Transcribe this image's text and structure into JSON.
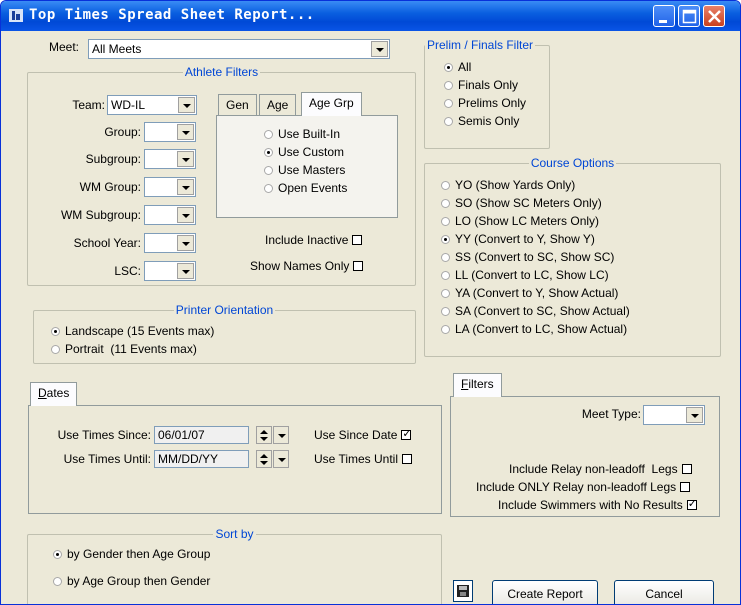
{
  "window": {
    "title": "Top Times Spread Sheet Report..."
  },
  "meet": {
    "label": "Meet:",
    "value": "All Meets"
  },
  "athlete_filters": {
    "legend": "Athlete Filters",
    "team": {
      "label": "Team:",
      "value": "WD-IL"
    },
    "group": {
      "label": "Group:",
      "value": ""
    },
    "subgroup": {
      "label": "Subgroup:",
      "value": ""
    },
    "wm_group": {
      "label": "WM Group:",
      "value": ""
    },
    "wm_subgroup": {
      "label": "WM Subgroup:",
      "value": ""
    },
    "school_year": {
      "label": "School Year:",
      "value": ""
    },
    "lsc": {
      "label": "LSC:",
      "value": ""
    },
    "tabs": [
      "Gen",
      "Age",
      "Age Grp"
    ],
    "age_options": [
      {
        "label": "Use Built-In",
        "selected": false
      },
      {
        "label": "Use Custom",
        "selected": true
      },
      {
        "label": "Use Masters",
        "selected": false
      },
      {
        "label": "Open Events",
        "selected": false
      }
    ],
    "include_inactive": {
      "label": "Include Inactive",
      "checked": false
    },
    "show_names_only": {
      "label": "Show Names Only",
      "checked": false
    }
  },
  "prelim_filter": {
    "legend": "Prelim / Finals Filter",
    "options": [
      {
        "label": "All",
        "selected": true
      },
      {
        "label": "Finals Only",
        "selected": false
      },
      {
        "label": "Prelims Only",
        "selected": false
      },
      {
        "label": "Semis Only",
        "selected": false
      }
    ]
  },
  "course_options": {
    "legend": "Course Options",
    "options": [
      {
        "label": "YO (Show Yards Only)",
        "selected": false
      },
      {
        "label": "SO (Show SC Meters Only)",
        "selected": false
      },
      {
        "label": "LO (Show LC Meters Only)",
        "selected": false
      },
      {
        "label": "YY (Convert to Y, Show Y)",
        "selected": true
      },
      {
        "label": "SS (Convert to SC, Show SC)",
        "selected": false
      },
      {
        "label": "LL (Convert to LC, Show LC)",
        "selected": false
      },
      {
        "label": "YA (Convert to Y, Show Actual)",
        "selected": false
      },
      {
        "label": "SA (Convert to SC, Show Actual)",
        "selected": false
      },
      {
        "label": "LA (Convert to LC, Show Actual)",
        "selected": false
      }
    ]
  },
  "printer": {
    "legend": "Printer Orientation",
    "options": [
      {
        "label": "Landscape (15 Events max)",
        "selected": true
      },
      {
        "label": "Portrait  (11 Events max)",
        "selected": false
      }
    ]
  },
  "dates": {
    "tab_first": "D",
    "tab_rest": "ates",
    "since": {
      "label": "Use Times Since:",
      "value": "06/01/07"
    },
    "until": {
      "label": "Use Times Until:",
      "value": "MM/DD/YY"
    },
    "use_since_date": {
      "label": "Use Since Date",
      "checked": true
    },
    "use_times_until": {
      "label": "Use Times Until",
      "checked": false
    }
  },
  "filters": {
    "tab_first": "F",
    "tab_rest": "ilters",
    "meet_type": {
      "label": "Meet Type:",
      "value": ""
    },
    "relay_nonleadoff": {
      "label": "Include Relay non-leadoff  Legs",
      "checked": false
    },
    "only_relay_nonleadoff": {
      "label": "Include ONLY Relay non-leadoff Legs",
      "checked": false
    },
    "no_results": {
      "label": "Include Swimmers with No Results",
      "checked": true
    }
  },
  "sort_by": {
    "legend": "Sort by",
    "options": [
      {
        "label": "by Gender then Age Group",
        "selected": true
      },
      {
        "label": "by Age Group then Gender",
        "selected": false
      }
    ]
  },
  "buttons": {
    "create_report": "Create Report",
    "cancel": "Cancel"
  }
}
